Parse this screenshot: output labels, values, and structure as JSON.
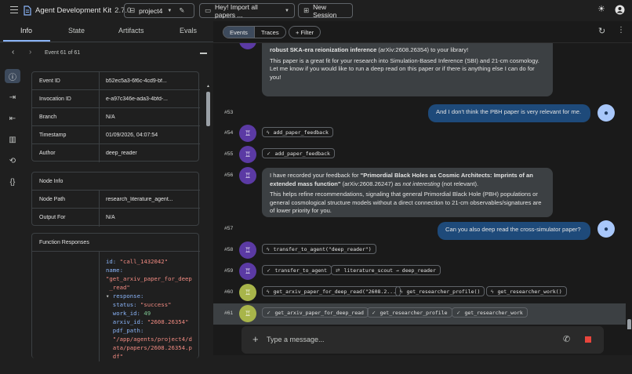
{
  "header": {
    "app_title": "Agent Development Kit",
    "version": "2.7.0",
    "app_select": "project4",
    "session_title": "Hey! Import all papers ...",
    "new_session": "New Session"
  },
  "left": {
    "tabs": [
      "Info",
      "State",
      "Artifacts",
      "Evals"
    ],
    "event_nav": "Event 61 of 61",
    "details": [
      [
        "Event ID",
        "b52ec5a3-6f6c-4cd9-bf..."
      ],
      [
        "Invocation ID",
        "e-a97c346e-ada3-4bfd-..."
      ],
      [
        "Branch",
        "N/A"
      ],
      [
        "Timestamp",
        "01/09/2026, 04:07:54"
      ],
      [
        "Author",
        "deep_reader"
      ]
    ],
    "node_info_title": "Node Info",
    "node_info": [
      [
        "Node Path",
        "research_literature_agent..."
      ],
      [
        "Output For",
        "N/A"
      ]
    ],
    "function_responses_title": "Function Responses",
    "code": {
      "id_key": "id:",
      "id_val": "\"call_1432042\"",
      "name_key": "name:",
      "name_val1": "\"get_arxiv_paper_for_deep",
      "name_val2": "_read\"",
      "resp_key": "response:",
      "status_key": "status:",
      "status_val": "\"success\"",
      "work_key": "work_id:",
      "work_val": "49",
      "arxiv_key": "arxiv_id:",
      "arxiv_val": "\"2608.26354\"",
      "pdf_key": "pdf_path:",
      "pdf_val1": "\"/app/agents/project4/d",
      "pdf_val2": "ata/papers/2608.26354.p",
      "pdf_val3": "df\""
    }
  },
  "right": {
    "segments": [
      "Events",
      "Traces"
    ],
    "filter": "+ Filter",
    "bot1": {
      "bold": "robust SKA-era reionization inference",
      "rest": " (arXiv:2608.26354) to your library!",
      "p2": "This paper is a great fit for your research into Simulation-Based Inference (SBI) and 21-cm cosmology. Let me know if you would like to run a deep read on this paper or if there is anything else I can do for you!"
    },
    "n53": "#53",
    "user53": "And I don't think the PBH paper is very relevant for me.",
    "n54": "#54",
    "chip54": "add_paper_feedback",
    "n55": "#55",
    "chip55": "add_paper_feedback",
    "n56": "#56",
    "bot56": {
      "a": "I have recorded your feedback for ",
      "b": "\"Primordial Black Holes as Cosmic Architects: Imprints of an extended mass function\"",
      "c": " (arXiv:2608.26247) as ",
      "d": "not interesting",
      "e": " (not relevant).",
      "p2": "This helps refine recommendations, signaling that general Primordial Black Hole (PBH) populations or general cosmological structure models without a direct connection to 21-cm observables/signatures are of lower priority for you."
    },
    "n57": "#57",
    "user57": "Can you also deep read the cross-simulator paper?",
    "n58": "#58",
    "chip58": "transfer_to_agent(\"deep_reader\")",
    "n59": "#59",
    "chip59a": "transfer_to_agent",
    "chip59b": "literature_scout → deep_reader",
    "n60": "#60",
    "chip60a": "get_arxiv_paper_for_deep_read(\"2608.2...",
    "chip60b": "get_researcher_profile()",
    "chip60c": "get_researcher_work()",
    "n61": "#61",
    "chip61a": "get_arxiv_paper_for_deep_read",
    "chip61b": "get_researcher_profile",
    "chip61c": "get_researcher_work",
    "input_placeholder": "Type a message..."
  }
}
